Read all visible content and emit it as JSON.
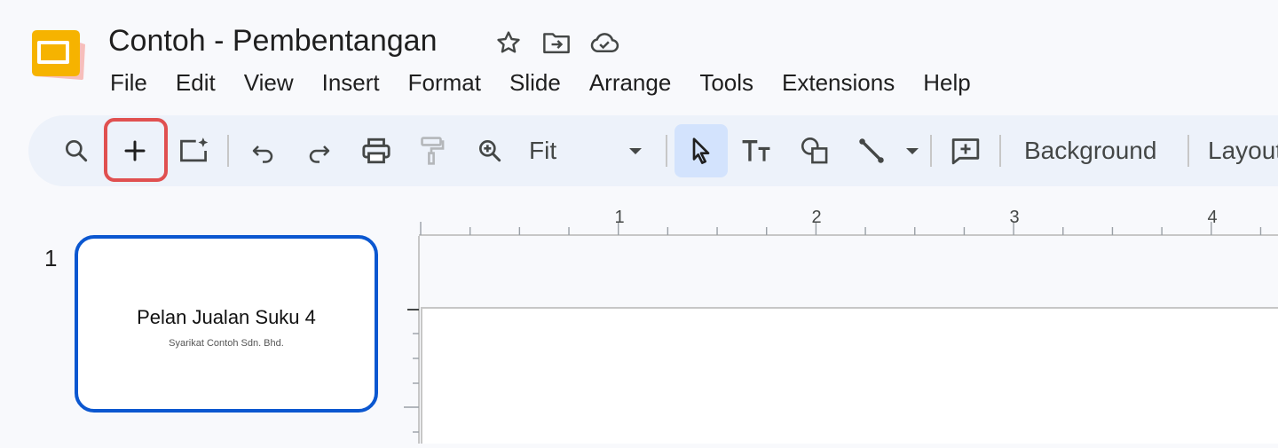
{
  "app": {
    "document_title": "Contoh - Pembentangan",
    "logo_icon": "slides-logo",
    "title_icons": [
      "star-icon",
      "move-to-folder-icon",
      "cloud-saved-icon"
    ]
  },
  "menu": {
    "items": [
      "File",
      "Edit",
      "View",
      "Insert",
      "Format",
      "Slide",
      "Arrange",
      "Tools",
      "Extensions",
      "Help"
    ]
  },
  "toolbar": {
    "zoom_value": "Fit",
    "background_label": "Background",
    "layout_label": "Layout",
    "highlight_color": "#e05050",
    "active_tool": "select"
  },
  "ruler": {
    "ticks": [
      "1",
      "2",
      "3",
      "4"
    ]
  },
  "slides": [
    {
      "number": "1",
      "title": "Pelan Jualan Suku 4",
      "subtitle": "Syarikat Contoh Sdn. Bhd.",
      "selected": true
    }
  ],
  "colors": {
    "accent": "#0b57d0",
    "toolbar_bg": "#edf2fa",
    "page_bg": "#f8f9fc"
  }
}
